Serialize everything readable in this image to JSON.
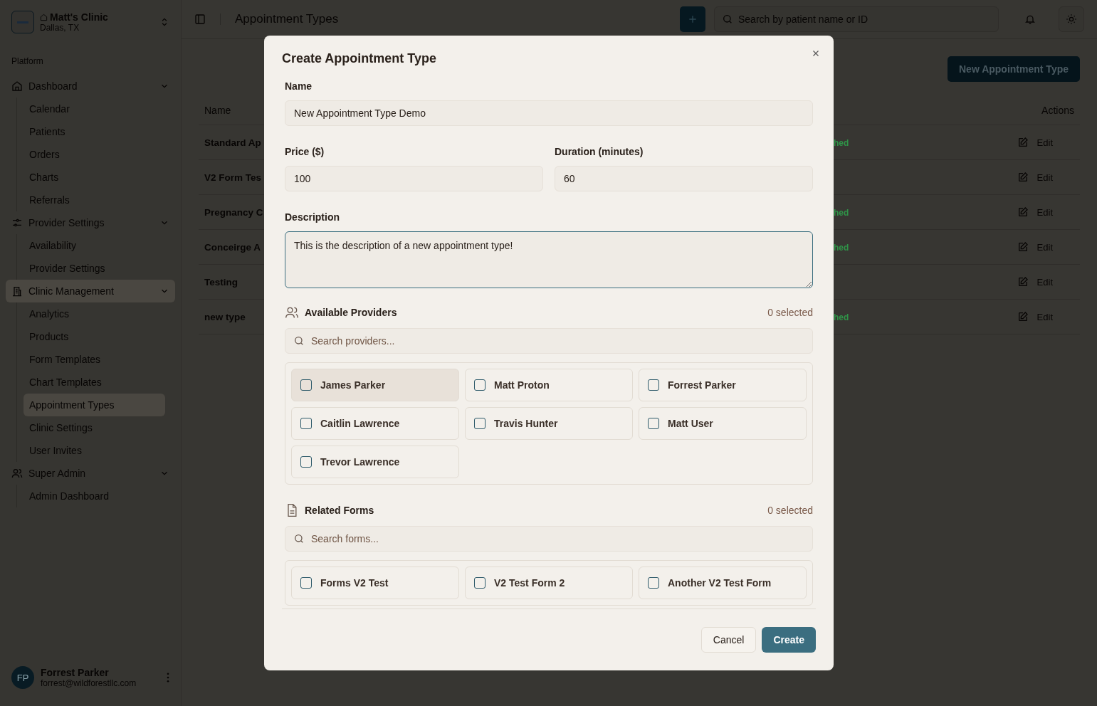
{
  "sidebar": {
    "clinic": {
      "name": "Matt's Clinic",
      "location": "Dallas, TX"
    },
    "section_label": "Platform",
    "groups": [
      {
        "label": "Dashboard",
        "expanded": true,
        "active": false,
        "children": [
          {
            "label": "Calendar",
            "selected": false
          },
          {
            "label": "Patients",
            "selected": false
          },
          {
            "label": "Orders",
            "selected": false
          },
          {
            "label": "Charts",
            "selected": false
          },
          {
            "label": "Referrals",
            "selected": false
          }
        ]
      },
      {
        "label": "Provider Settings",
        "expanded": true,
        "active": false,
        "children": [
          {
            "label": "Availability",
            "selected": false
          },
          {
            "label": "Provider Settings",
            "selected": false
          }
        ]
      },
      {
        "label": "Clinic Management",
        "expanded": true,
        "active": true,
        "children": [
          {
            "label": "Analytics",
            "selected": false
          },
          {
            "label": "Products",
            "selected": false
          },
          {
            "label": "Form Templates",
            "selected": false
          },
          {
            "label": "Chart Templates",
            "selected": false
          },
          {
            "label": "Appointment Types",
            "selected": true
          },
          {
            "label": "Clinic Settings",
            "selected": false
          },
          {
            "label": "User Invites",
            "selected": false
          }
        ]
      },
      {
        "label": "Super Admin",
        "expanded": true,
        "active": false,
        "children": [
          {
            "label": "Admin Dashboard",
            "selected": false
          }
        ]
      }
    ],
    "user": {
      "initials": "FP",
      "name": "Forrest Parker",
      "email": "forrest@wildforestllc.com"
    }
  },
  "header": {
    "title": "Appointment Types",
    "search_placeholder": "Search by patient name or ID"
  },
  "page": {
    "new_button": "New Appointment Type",
    "columns": [
      "Name",
      "Actions"
    ],
    "rows": [
      {
        "name": "Standard Ap",
        "status": "hed",
        "action": "Edit"
      },
      {
        "name": "V2 Form Tes",
        "action": "Edit"
      },
      {
        "name": "Pregnancy C",
        "status": "hed",
        "action": "Edit"
      },
      {
        "name": "Conceirge A",
        "status": "hed",
        "action": "Edit"
      },
      {
        "name": "Testing",
        "action": "Edit"
      },
      {
        "name": "new type",
        "status": "hed",
        "action": "Edit"
      }
    ]
  },
  "modal": {
    "title": "Create Appointment Type",
    "name": {
      "label": "Name",
      "value": "New Appointment Type Demo"
    },
    "price": {
      "label": "Price ($)",
      "value": "100"
    },
    "duration": {
      "label": "Duration (minutes)",
      "value": "60"
    },
    "description": {
      "label": "Description",
      "value": "This is the description of a new appointment type!",
      "focused": true
    },
    "providers": {
      "label": "Available Providers",
      "count": "0 selected",
      "search_placeholder": "Search providers...",
      "items": [
        {
          "name": "James Parker",
          "checked": false,
          "highlighted": true
        },
        {
          "name": "Matt Proton",
          "checked": false,
          "highlighted": false
        },
        {
          "name": "Forrest Parker",
          "checked": false,
          "highlighted": false
        },
        {
          "name": "Caitlin Lawrence",
          "checked": false,
          "highlighted": false
        },
        {
          "name": "Travis Hunter",
          "checked": false,
          "highlighted": false
        },
        {
          "name": "Matt User",
          "checked": false,
          "highlighted": false
        },
        {
          "name": "Trevor Lawrence",
          "checked": false,
          "highlighted": false
        }
      ]
    },
    "forms": {
      "label": "Related Forms",
      "count": "0 selected",
      "search_placeholder": "Search forms...",
      "items": [
        {
          "name": "Forms V2 Test",
          "checked": false,
          "highlighted": false
        },
        {
          "name": "V2 Test Form 2",
          "checked": false,
          "highlighted": false
        },
        {
          "name": "Another V2 Test Form",
          "checked": false,
          "highlighted": false
        }
      ]
    },
    "cancel": "Cancel",
    "create": "Create"
  }
}
